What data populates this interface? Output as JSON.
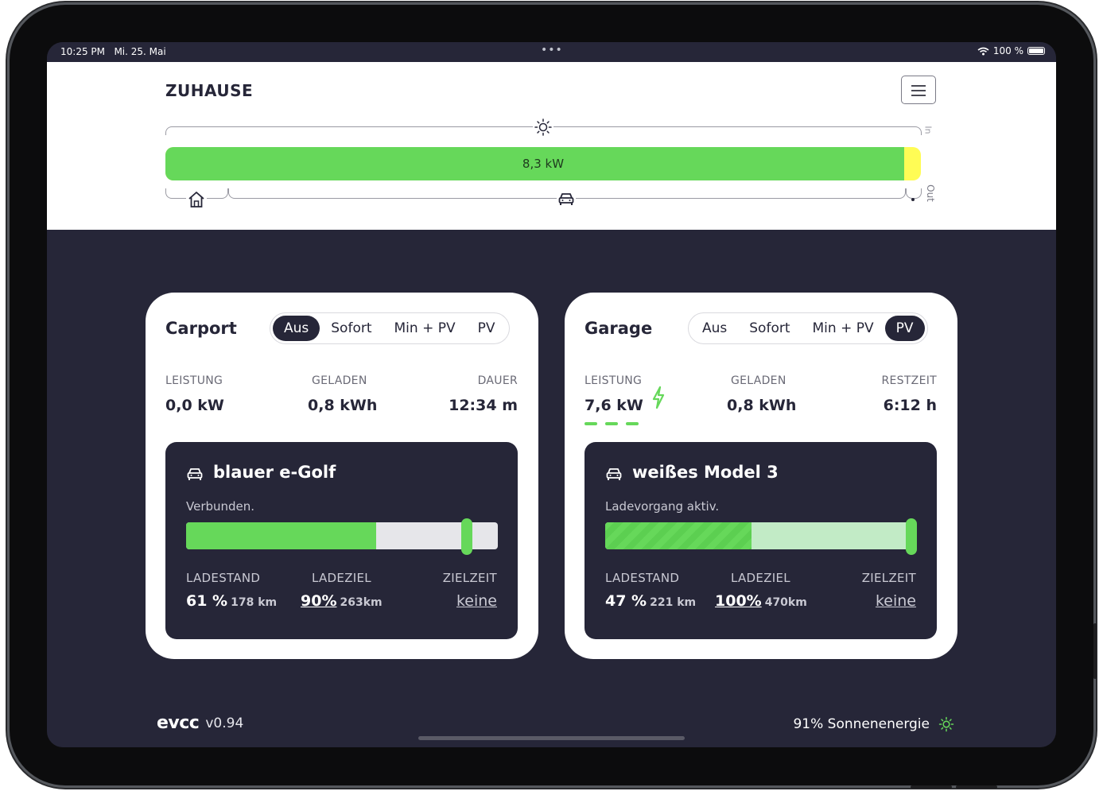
{
  "statusbar": {
    "time": "10:25 PM",
    "date": "Mi. 25. Mai",
    "battery": "100 %"
  },
  "header": {
    "title": "ZUHAUSE",
    "in_label": "In",
    "out_label": "Out",
    "power_total": "8,3 kW",
    "pv_fraction": 0.978
  },
  "loadpoints": [
    {
      "title": "Carport",
      "modes": [
        "Aus",
        "Sofort",
        "Min + PV",
        "PV"
      ],
      "active_mode": "Aus",
      "m1_label": "LEISTUNG",
      "m1_value": "0,0 kW",
      "m2_label": "GELADEN",
      "m2_value": "0,8 kWh",
      "m3_label": "DAUER",
      "m3_value": "12:34 m",
      "vehicle": {
        "name": "blauer e-Golf",
        "status": "Verbunden.",
        "soc_fraction": 0.61,
        "target_fraction": 0.9,
        "soc_label": "LADESTAND",
        "soc_value": "61 %",
        "soc_range": "178 km",
        "target_label": "LADEZIEL",
        "target_value": "90%",
        "target_range": "263km",
        "time_label": "ZIELZEIT",
        "time_value": "keine"
      }
    },
    {
      "title": "Garage",
      "modes": [
        "Aus",
        "Sofort",
        "Min + PV",
        "PV"
      ],
      "active_mode": "PV",
      "m1_label": "LEISTUNG",
      "m1_value": "7,6 kW",
      "m2_label": "GELADEN",
      "m2_value": "0,8 kWh",
      "m3_label": "RESTZEIT",
      "m3_value": "6:12 h",
      "vehicle": {
        "name": "weißes Model 3",
        "status": "Ladevorgang aktiv.",
        "soc_fraction": 0.47,
        "target_fraction": 1.0,
        "soc_label": "LADESTAND",
        "soc_value": "47 %",
        "soc_range": "221 km",
        "target_label": "LADEZIEL",
        "target_value": "100%",
        "target_range": "470km",
        "time_label": "ZIELZEIT",
        "time_value": "keine"
      }
    }
  ],
  "footer": {
    "logo": "evcc",
    "version": "v0.94",
    "solar": "91% Sonnenenergie"
  },
  "colors": {
    "accent_green": "#66d85a",
    "dark": "#262638",
    "grid_yellow": "#fffc55",
    "light_green": "#c2ebc6"
  }
}
